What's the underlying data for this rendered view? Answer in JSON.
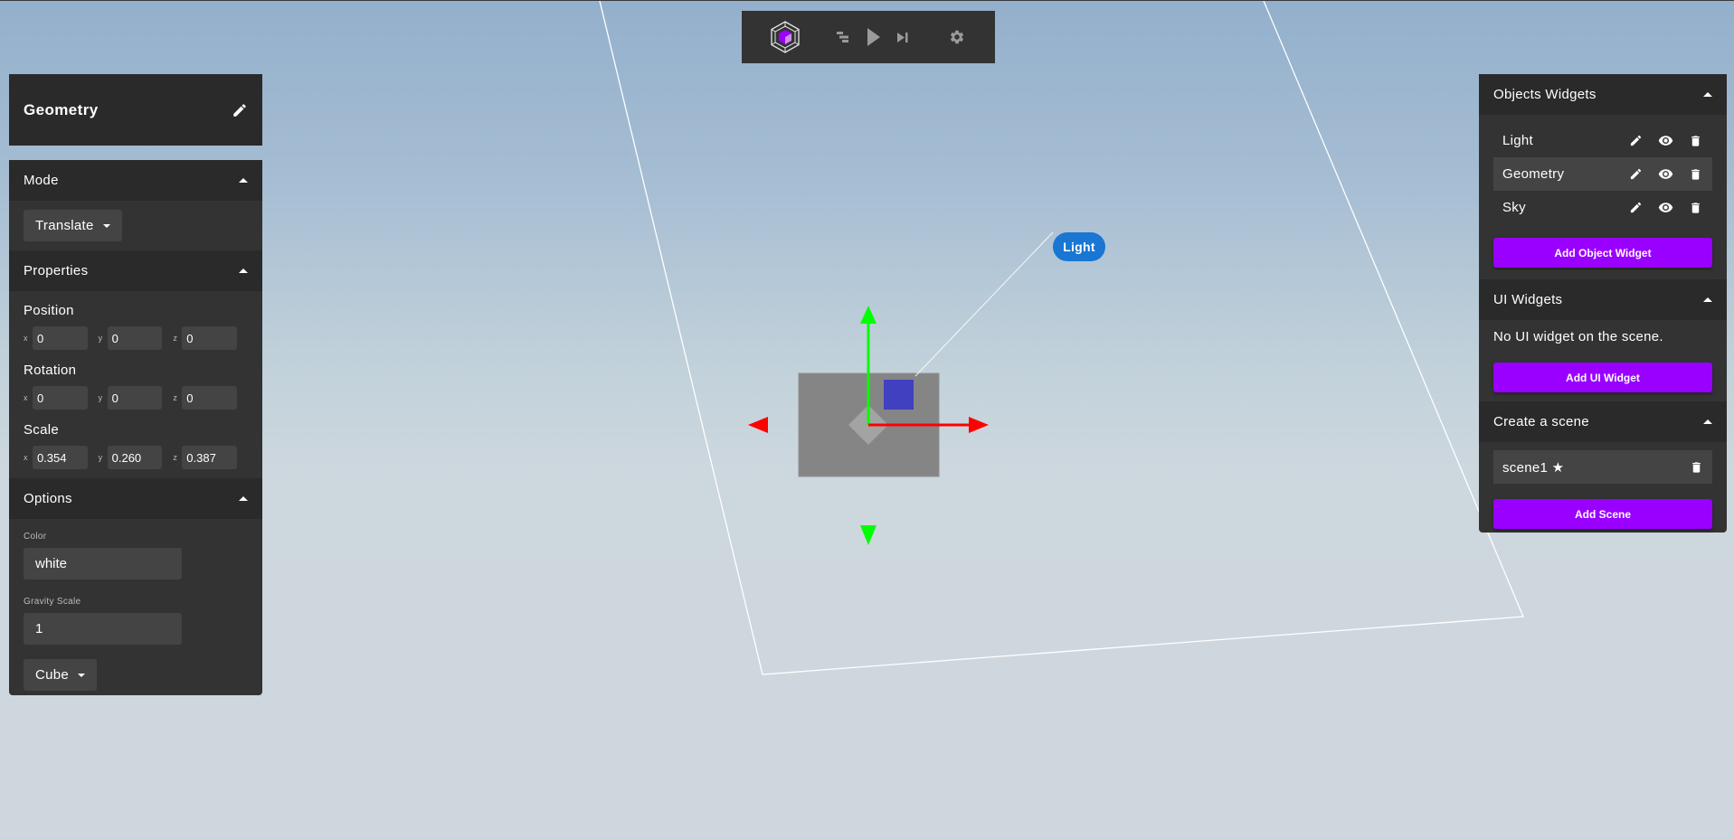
{
  "toolbar": {
    "logo_icon": "cube-logo-icon",
    "buttons": [
      {
        "icon": "align-icon",
        "label": "Align"
      },
      {
        "icon": "play-icon",
        "label": "Play"
      },
      {
        "icon": "skip-next-icon",
        "label": "Step"
      },
      {
        "icon": "gear-icon",
        "label": "Settings"
      }
    ]
  },
  "selected_object": {
    "title": "Geometry",
    "edit_icon": "pencil-icon"
  },
  "left_panel": {
    "mode": {
      "header": "Mode",
      "value": "Translate"
    },
    "properties": {
      "header": "Properties",
      "position": {
        "label": "Position",
        "x": "0",
        "y": "0",
        "z": "0"
      },
      "rotation": {
        "label": "Rotation",
        "x": "0",
        "y": "0",
        "z": "0"
      },
      "scale": {
        "label": "Scale",
        "x": "0.354",
        "y": "0.260",
        "z": "0.387"
      },
      "axis_labels": {
        "x": "x",
        "y": "y",
        "z": "z"
      }
    },
    "options": {
      "header": "Options",
      "color_label": "Color",
      "color_value": "white",
      "gravity_label": "Gravity Scale",
      "gravity_value": "1",
      "shape_value": "Cube"
    }
  },
  "right_panel": {
    "objects": {
      "header": "Objects Widgets",
      "items": [
        {
          "label": "Light",
          "selected": false
        },
        {
          "label": "Geometry",
          "selected": true
        },
        {
          "label": "Sky",
          "selected": false
        }
      ],
      "add_button": "Add Object Widget"
    },
    "ui_widgets": {
      "header": "UI Widgets",
      "empty_text": "No UI widget on the scene.",
      "add_button": "Add UI Widget"
    },
    "scenes": {
      "header": "Create a scene",
      "items": [
        {
          "label": "scene1 ★"
        }
      ],
      "add_button": "Add Scene"
    }
  },
  "viewport": {
    "light_label": "Light"
  },
  "colors": {
    "accent": "#9900ff",
    "panel": "#333333",
    "panel_header": "#2a2a2a",
    "input": "#444444",
    "light_badge": "#1976d2",
    "gizmo_x": "#ff0000",
    "gizmo_y": "#00ff00",
    "light_helper": "#4040c0"
  }
}
